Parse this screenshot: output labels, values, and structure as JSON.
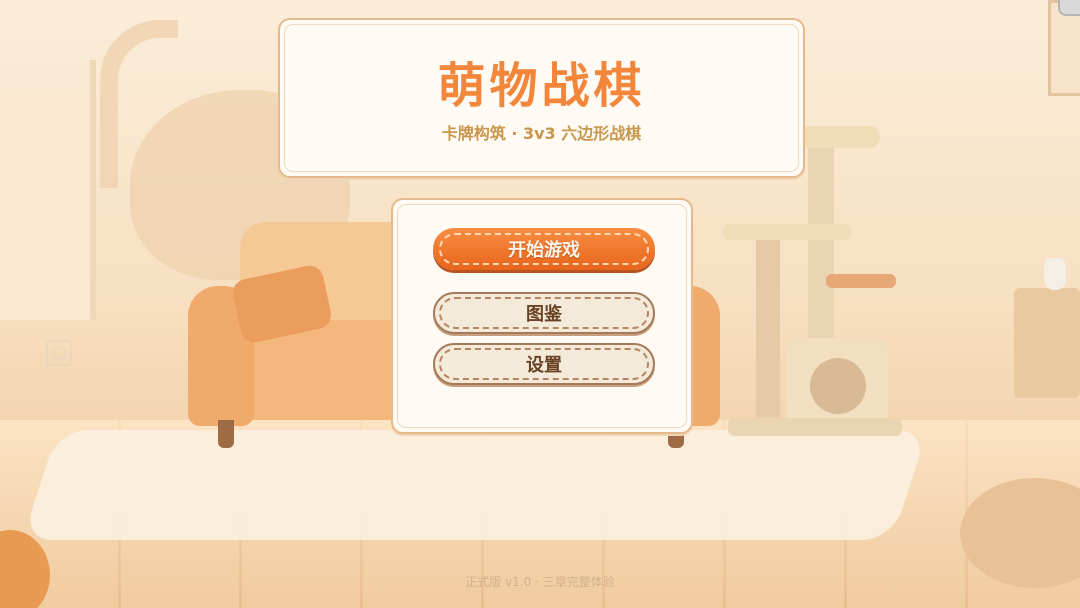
{
  "title": {
    "main": "萌物战棋",
    "subtitle": "卡牌构筑 · 3v3 六边形战棋"
  },
  "menu": {
    "start": "开始游戏",
    "collection": "图鉴",
    "settings": "设置"
  },
  "footer": {
    "version": "正式版 v1.0 · 三章完整体验"
  },
  "colors": {
    "accent": "#f2873b",
    "subtitle": "#c8964c",
    "primary_button": "#ee7530",
    "secondary_button": "#f3ead9",
    "panel": "#fffaf3"
  }
}
